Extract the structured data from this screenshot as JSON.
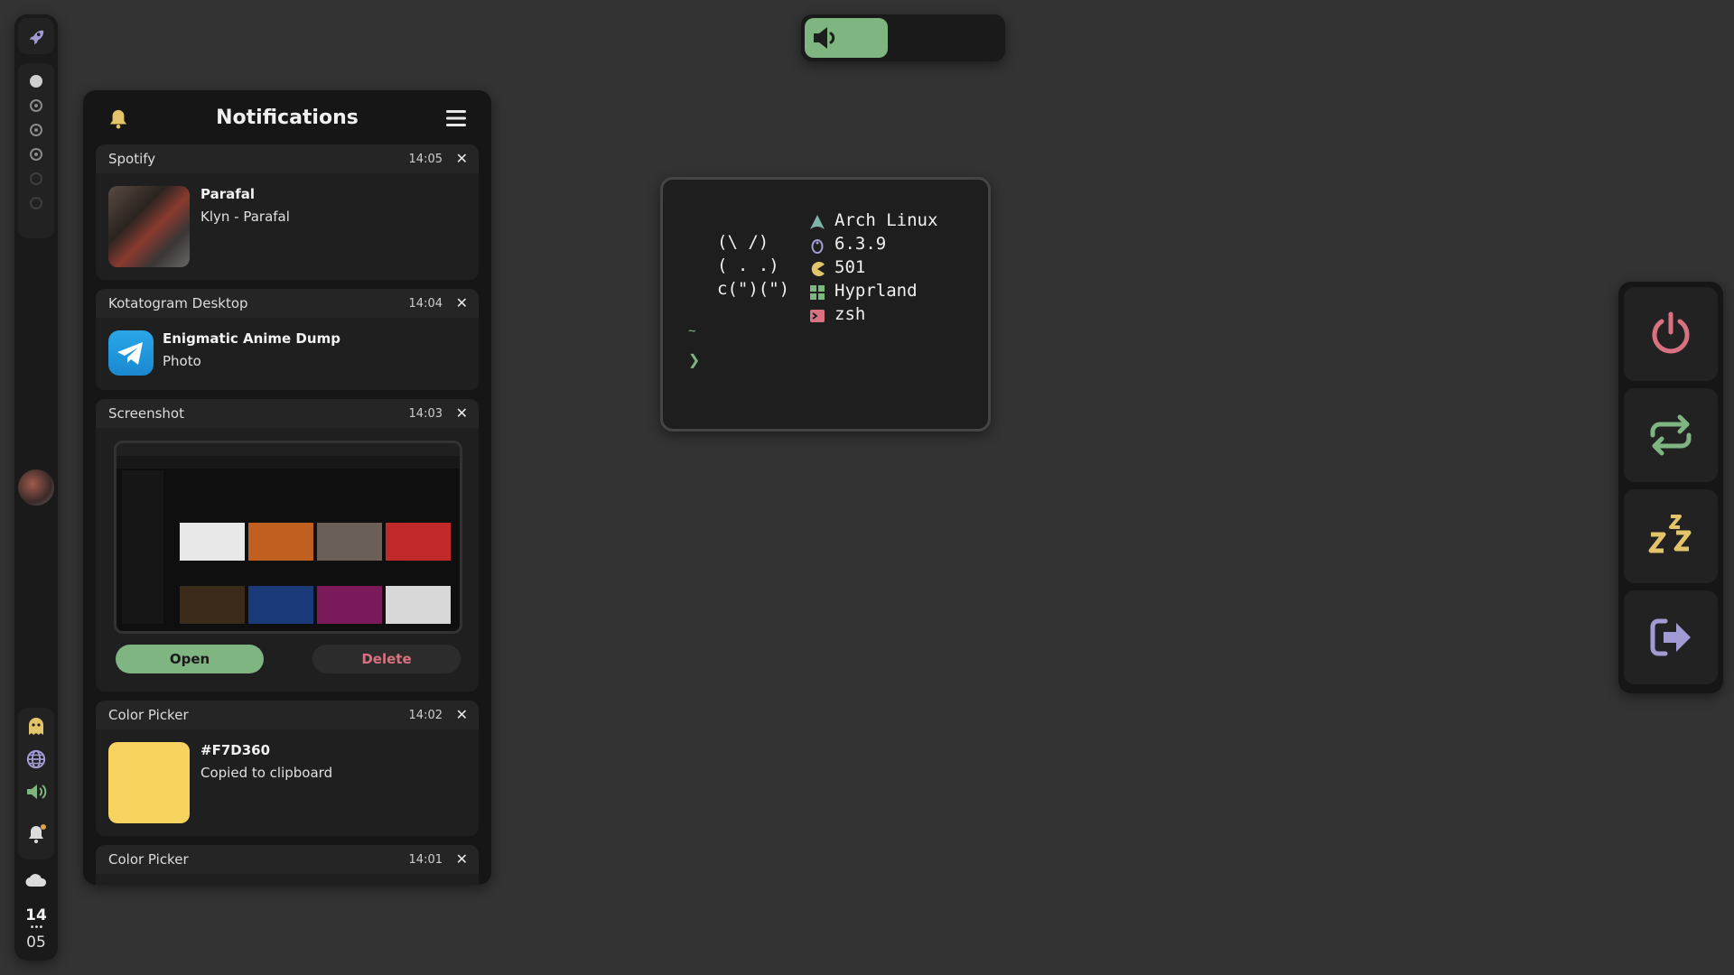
{
  "colors": {
    "background": "#333333",
    "panel": "#1a1a1a",
    "accent_green": "#7fb581",
    "accent_red": "#d87281",
    "accent_purple": "#a19bd4",
    "accent_yellow": "#e3c46a",
    "picked_color": "#F7D360"
  },
  "leftbar": {
    "launcher_icon": "rocket-icon",
    "workspaces": [
      {
        "state": "active"
      },
      {
        "state": "occupied"
      },
      {
        "state": "occupied"
      },
      {
        "state": "occupied"
      },
      {
        "state": "empty"
      },
      {
        "state": "empty"
      }
    ],
    "tray_icons": [
      "ghost-icon",
      "globe-icon",
      "speaker-icon"
    ],
    "notification_icon": "bell-icon",
    "weather_icon": "cloud-icon",
    "clock": {
      "hour": "14",
      "sep": "•••",
      "minute": "05"
    }
  },
  "volume": {
    "icon": "speaker-icon",
    "level_percent": 42
  },
  "notifications": {
    "title": "Notifications",
    "items": [
      {
        "app": "Spotify",
        "time": "14:05",
        "summary": "Parafal",
        "body": "Klyn - Parafal",
        "close": "✕"
      },
      {
        "app": "Kotatogram Desktop",
        "time": "14:04",
        "summary": "Enigmatic Anime Dump",
        "body": "Photo",
        "close": "✕"
      },
      {
        "app": "Screenshot",
        "time": "14:03",
        "close": "✕",
        "actions": {
          "open": "Open",
          "delete": "Delete"
        }
      },
      {
        "app": "Color Picker",
        "time": "14:02",
        "summary": "#F7D360",
        "body": "Copied to clipboard",
        "close": "✕"
      },
      {
        "app": "Color Picker",
        "time": "14:01",
        "close": "✕"
      }
    ]
  },
  "terminal": {
    "ascii": [
      "(\\ /)",
      "( . .)",
      "c(\")(\")"
    ],
    "info": [
      {
        "icon": "arch-icon",
        "text": "Arch Linux"
      },
      {
        "icon": "linux-icon",
        "text": "6.3.9"
      },
      {
        "icon": "pacman-icon",
        "text": "501"
      },
      {
        "icon": "hyprland-icon",
        "text": "Hyprland"
      },
      {
        "icon": "terminal-icon",
        "text": "zsh"
      }
    ],
    "cwd": "~",
    "prompt": "❯"
  },
  "power_menu": {
    "buttons": [
      "power-icon",
      "reboot-icon",
      "sleep-icon",
      "logout-icon"
    ]
  }
}
